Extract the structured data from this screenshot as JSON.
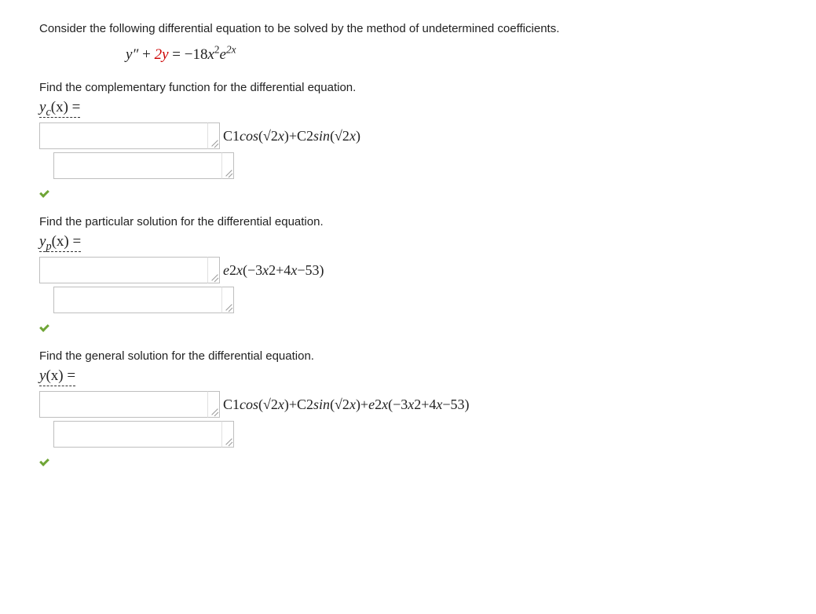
{
  "intro": "Consider the following differential equation to be solved by the method of undetermined coefficients.",
  "equation": {
    "lhs_1": "y″",
    "plus": " + ",
    "red_term": "2y",
    "eq": " = ",
    "rhs_coef": "−18",
    "rhs_x": "x",
    "rhs_sq": "2",
    "rhs_e": "e",
    "rhs_exp": "2x"
  },
  "parts": [
    {
      "prompt": "Find the complementary function for the differential equation.",
      "label_var": "y",
      "label_sub": "c",
      "label_arg": "(x) =",
      "answer_plain": "C1cos(√2x)+C2sin(√2x)"
    },
    {
      "prompt": "Find the particular solution for the differential equation.",
      "label_var": "y",
      "label_sub": "p",
      "label_arg": "(x) =",
      "answer_plain": "e2x(−3x2+4x−53)"
    },
    {
      "prompt": "Find the general solution for the differential equation.",
      "label_var": "y",
      "label_sub": "",
      "label_arg": "(x) =",
      "answer_plain": "C1cos(√2x)+C2sin(√2x)+e2x(−3x2+4x−53)"
    }
  ]
}
